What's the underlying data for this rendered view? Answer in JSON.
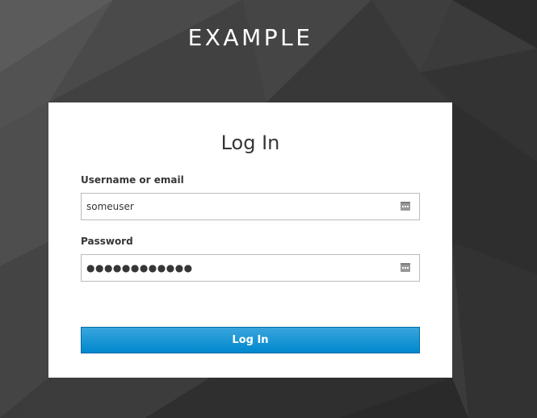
{
  "brand": {
    "name": "EXAMPLE"
  },
  "login_form": {
    "title": "Log In",
    "username": {
      "label": "Username or email",
      "value": "someuser"
    },
    "password": {
      "label": "Password",
      "value": "●●●●●●●●●●●●"
    },
    "submit_label": "Log In"
  },
  "colors": {
    "button": "#0088ce",
    "button_top": "#39a5dc",
    "background": "#3a3a3a",
    "card": "#ffffff"
  },
  "icons": {
    "field_icon": "password-manager-icon"
  }
}
